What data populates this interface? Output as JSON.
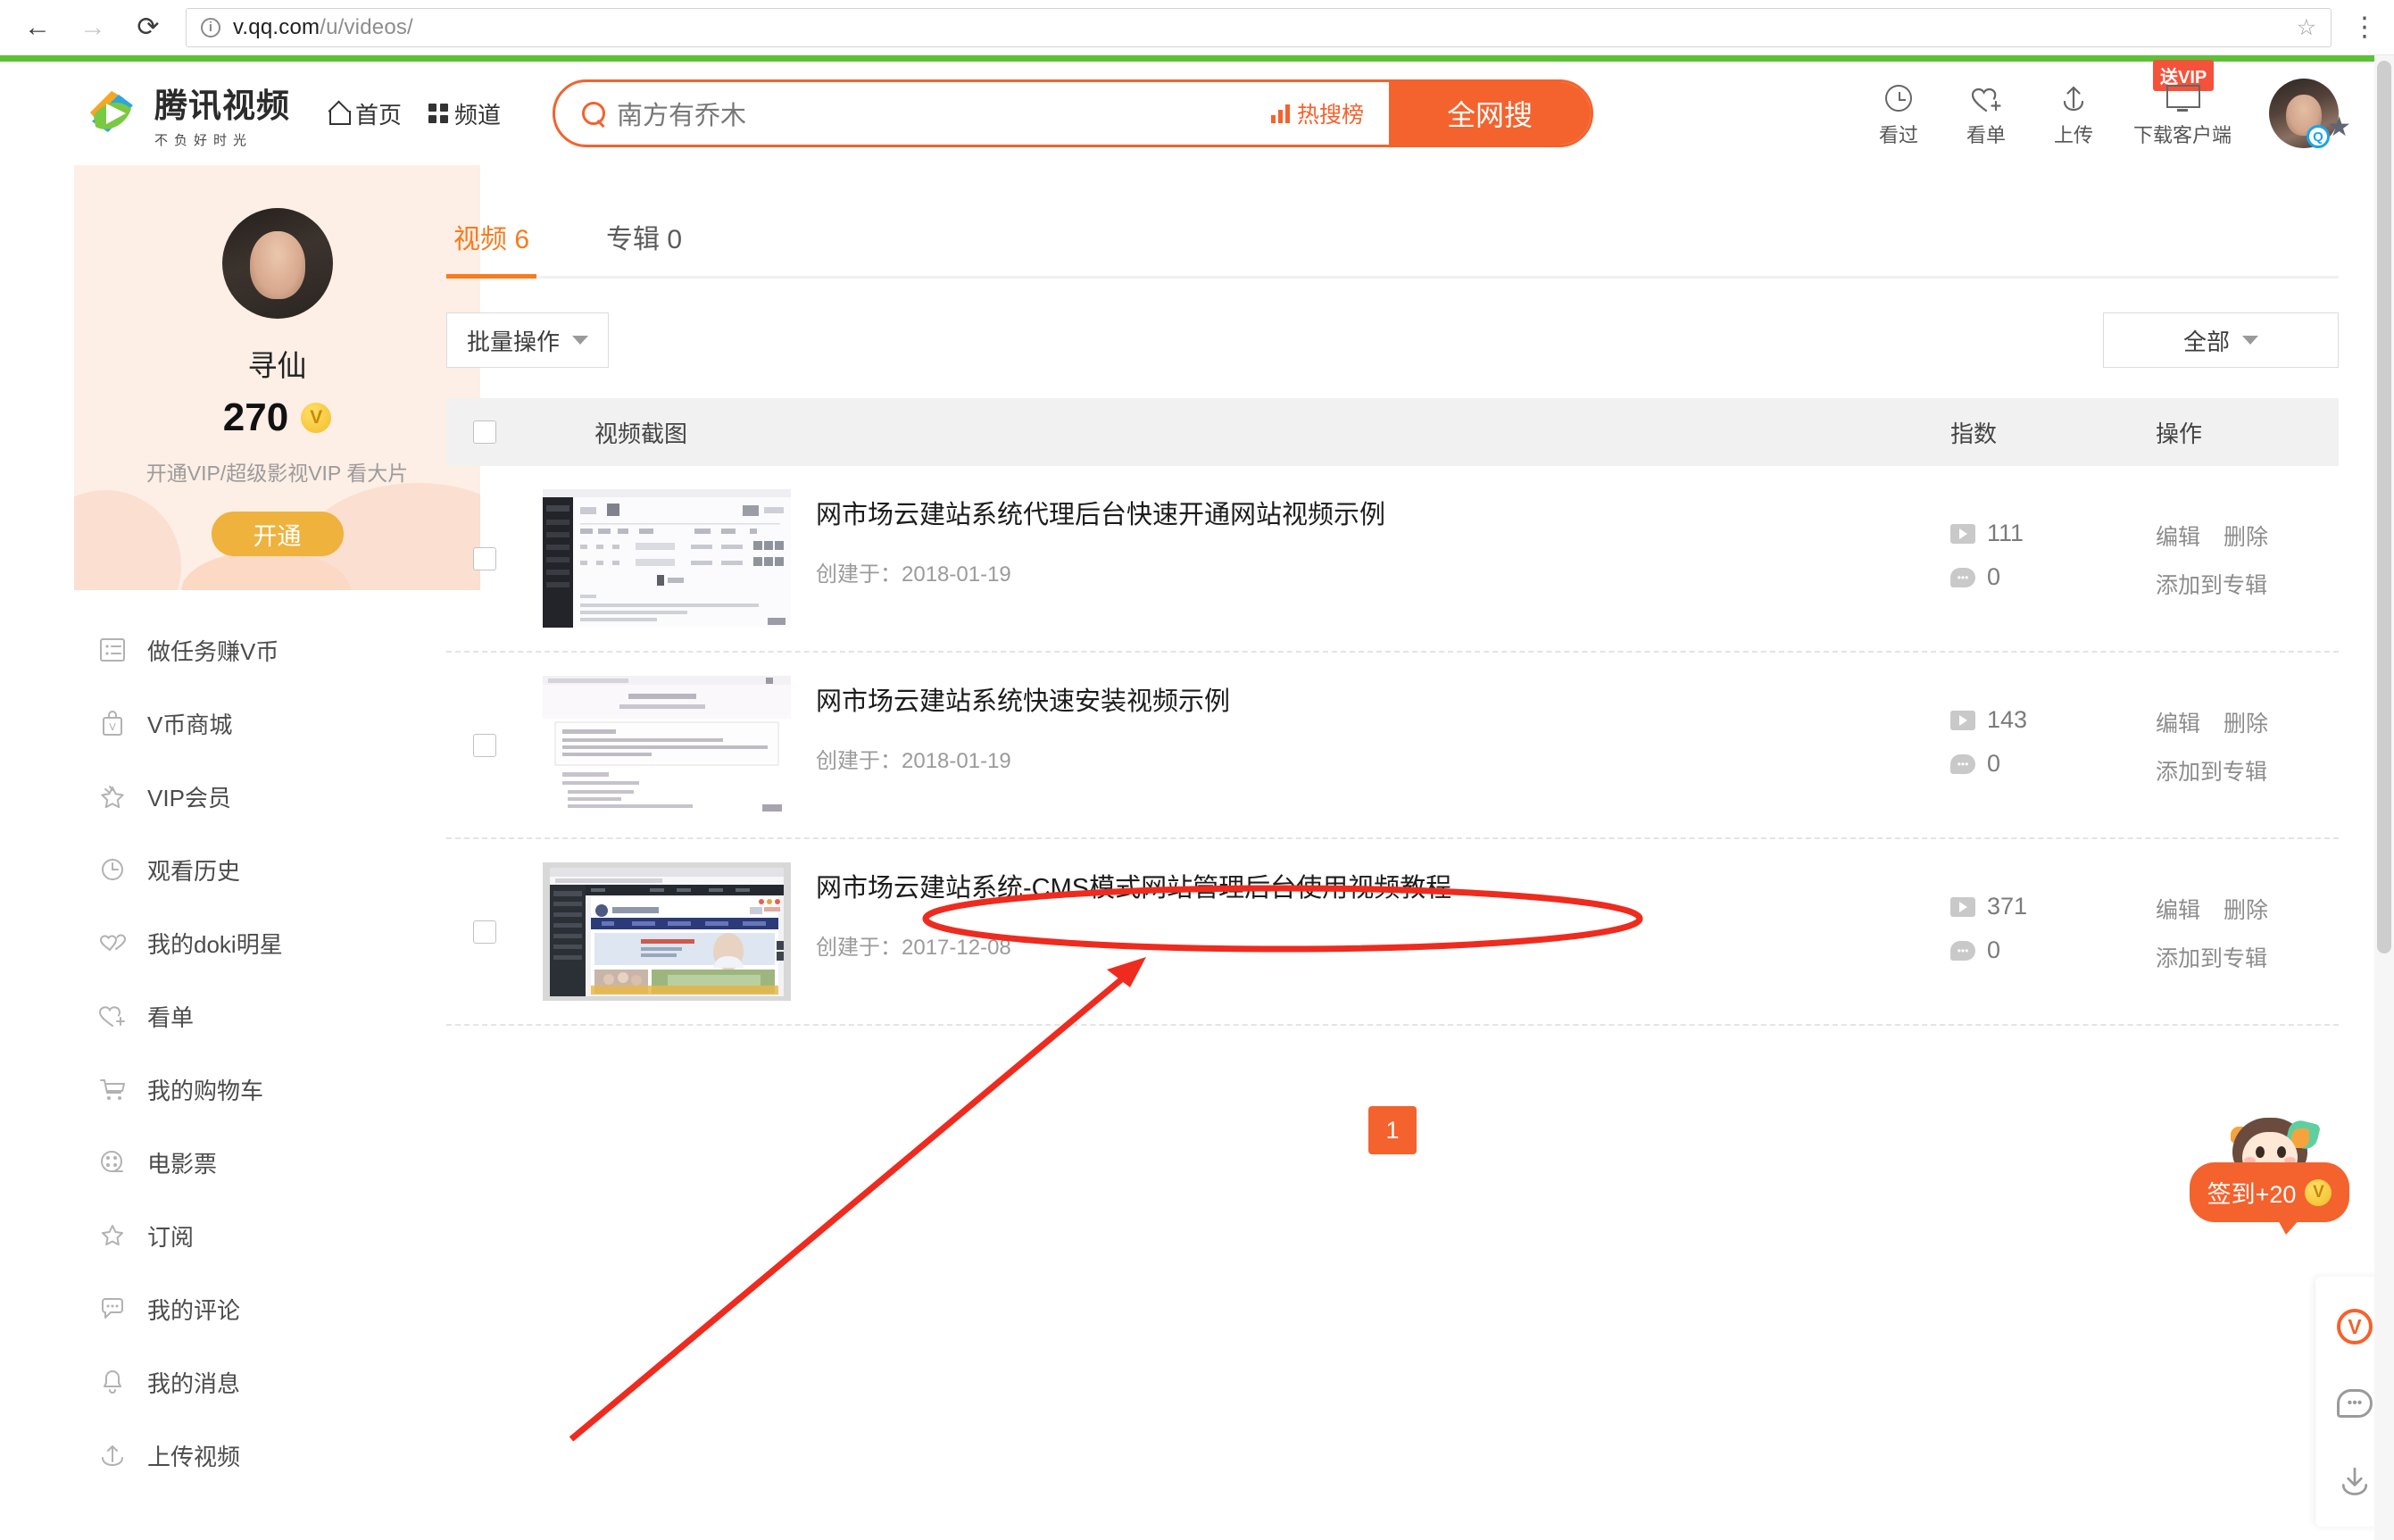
{
  "browser": {
    "back_icon": "back-arrow-icon",
    "forward_icon": "forward-arrow-icon",
    "reload_icon": "reload-icon",
    "site_info_icon": "info-icon",
    "url_host": "v.qq.com",
    "url_path": "/u/videos/",
    "bookmark_icon": "star-outline-icon",
    "menu_icon": "kebab-menu-icon"
  },
  "header": {
    "logo_title": "腾讯视频",
    "logo_sub": "不负好时光",
    "nav": [
      {
        "label": "首页",
        "icon": "home-icon"
      },
      {
        "label": "频道",
        "icon": "grid-icon"
      }
    ],
    "search": {
      "value": "南方有乔木",
      "placeholder": "南方有乔木",
      "hot_rank_label": "热搜榜",
      "button_label": "全网搜"
    },
    "tools": [
      {
        "label": "看过",
        "icon": "clock-icon"
      },
      {
        "label": "看单",
        "icon": "heart-plus-icon"
      },
      {
        "label": "上传",
        "icon": "upload-icon"
      },
      {
        "label": "下载客户端",
        "icon": "monitor-icon",
        "badge": "送VIP"
      }
    ],
    "avatar_name": "user-avatar"
  },
  "sidebar": {
    "profile": {
      "name": "寻仙",
      "coins": "270",
      "coin_symbol": "V",
      "tip": "开通VIP/超级影视VIP 看大片",
      "button_label": "开通"
    },
    "items": [
      {
        "label": "做任务赚V币",
        "icon": "task-list-icon"
      },
      {
        "label": "V币商城",
        "icon": "vcoin-shop-icon"
      },
      {
        "label": "VIP会员",
        "icon": "vip-star-icon"
      },
      {
        "label": "观看历史",
        "icon": "clock-icon"
      },
      {
        "label": "我的doki明星",
        "icon": "doki-hearts-icon"
      },
      {
        "label": "看单",
        "icon": "heart-plus-icon"
      },
      {
        "label": "我的购物车",
        "icon": "cart-icon"
      },
      {
        "label": "电影票",
        "icon": "film-reel-icon"
      },
      {
        "label": "订阅",
        "icon": "star-icon"
      },
      {
        "label": "我的评论",
        "icon": "comment-icon"
      },
      {
        "label": "我的消息",
        "icon": "bell-icon"
      },
      {
        "label": "上传视频",
        "icon": "upload-icon"
      }
    ]
  },
  "main": {
    "tabs": [
      {
        "label": "视频 6",
        "active": true
      },
      {
        "label": "专辑 0",
        "active": false
      }
    ],
    "toolbar": {
      "batch_label": "批量操作",
      "filter_label": "全部"
    },
    "table": {
      "headers": {
        "screenshot": "视频截图",
        "index": "指数",
        "actions": "操作"
      },
      "rows": [
        {
          "title": "网市场云建站系统代理后台快速开通网站视频示例",
          "date": "创建于：2018-01-19",
          "plays": "111",
          "comments": "0",
          "actions": [
            "编辑",
            "删除",
            "添加到专辑"
          ]
        },
        {
          "title": "网市场云建站系统快速安装视频示例",
          "date": "创建于：2018-01-19",
          "plays": "143",
          "comments": "0",
          "actions": [
            "编辑",
            "删除",
            "添加到专辑"
          ]
        },
        {
          "title": "网市场云建站系统-CMS模式网站管理后台使用视频教程",
          "date": "创建于：2017-12-08",
          "plays": "371",
          "comments": "0",
          "actions": [
            "编辑",
            "删除",
            "添加到专辑"
          ]
        }
      ]
    },
    "pagination": {
      "current": "1"
    }
  },
  "widgets": {
    "checkin": {
      "label": "签到+20",
      "coin_symbol": "V"
    },
    "rail": [
      {
        "icon": "vcoin-circle-icon",
        "symbol": "V"
      },
      {
        "icon": "feedback-comment-icon"
      },
      {
        "icon": "download-icon"
      }
    ]
  },
  "colors": {
    "brand_orange": "#f4622d",
    "tab_orange": "#f57c1f",
    "green_rule": "#5cc235",
    "vip_gold": "#eeb23d",
    "annotation_red": "#ee2b1e"
  }
}
